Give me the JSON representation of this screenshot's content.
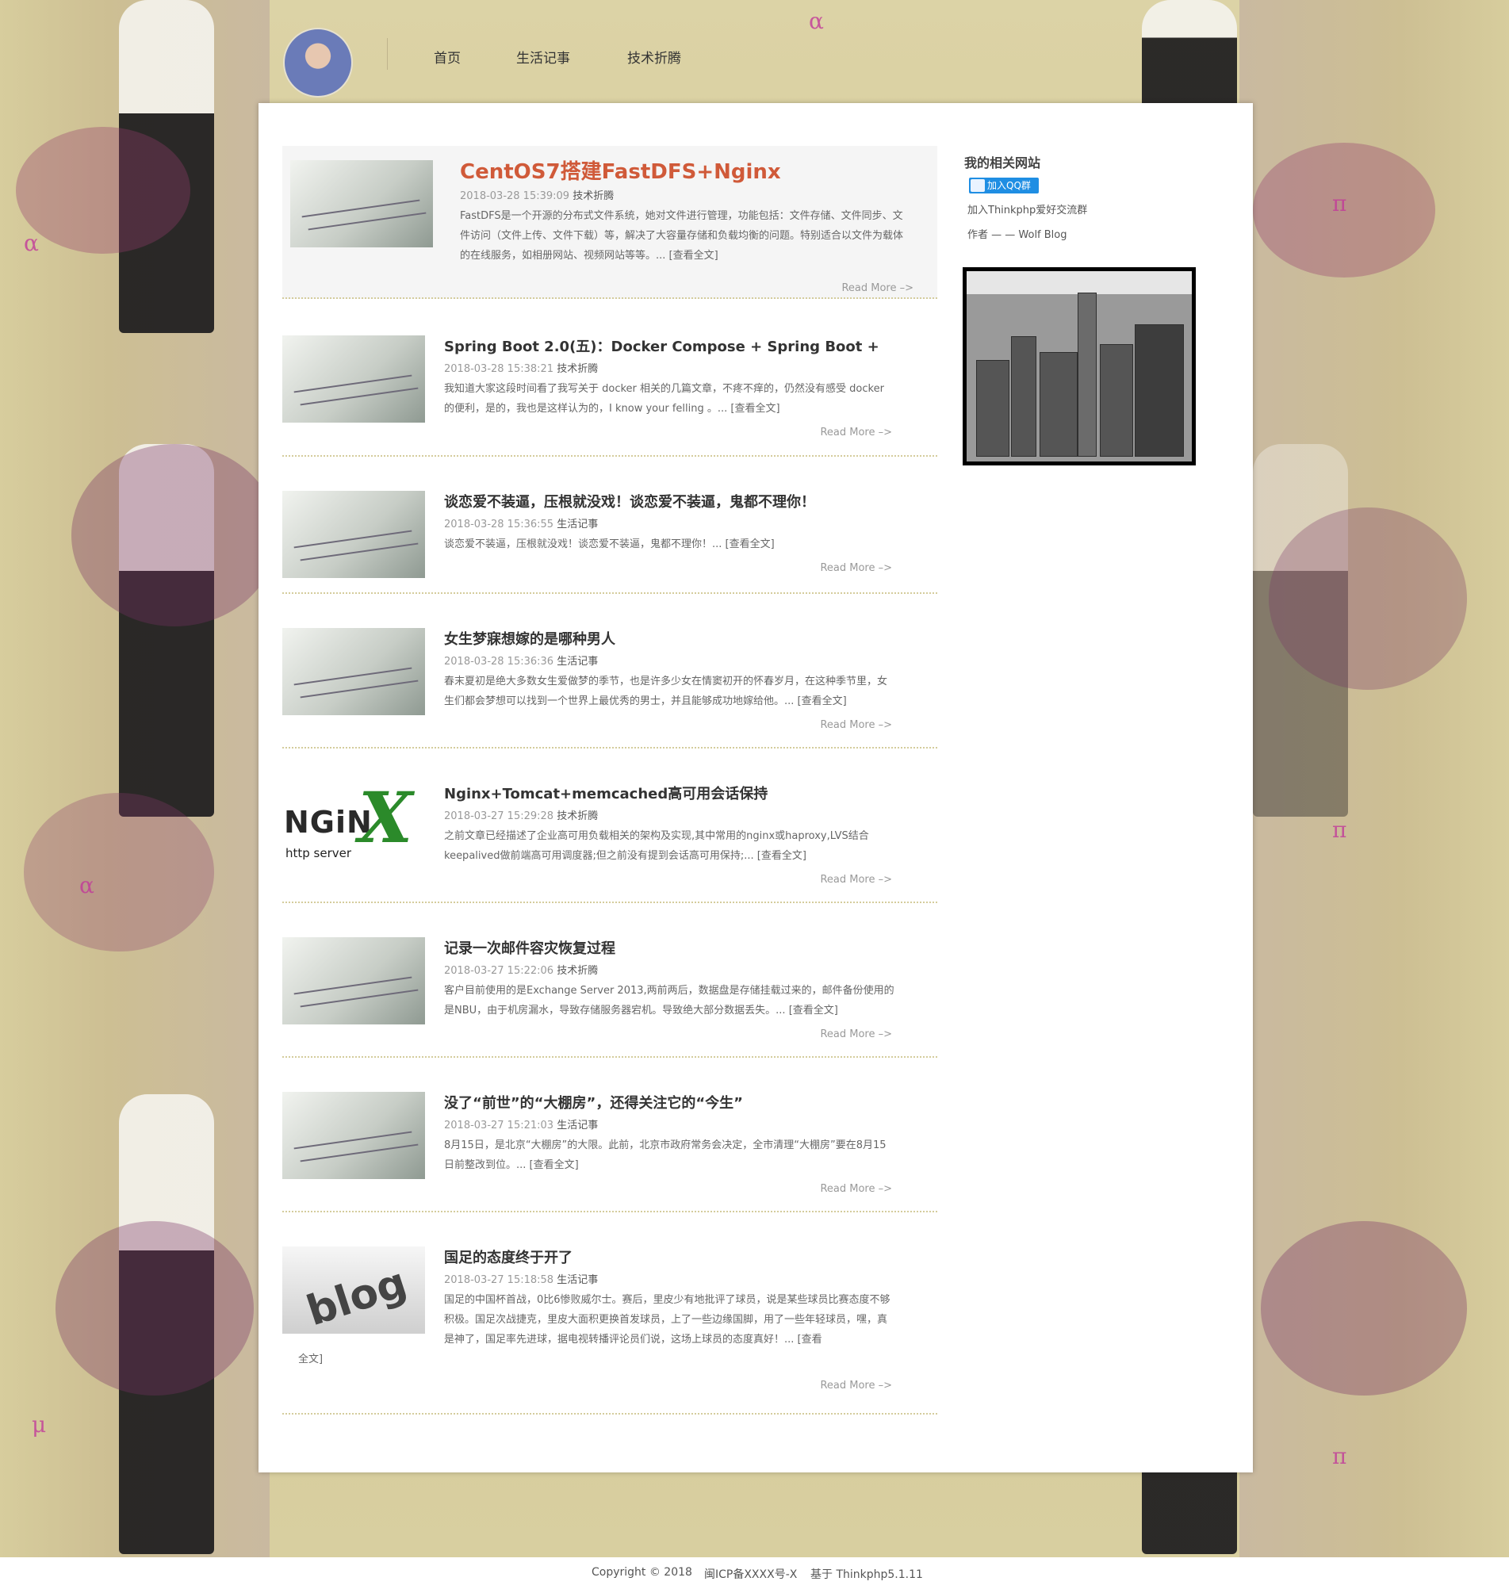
{
  "nav": {
    "items": [
      "首页",
      "生活记事",
      "技术折腾"
    ]
  },
  "posts": [
    {
      "title": "CentOS7搭建FastDFS+Nginx",
      "date": "2018-03-28 15:39:09",
      "category": "技术折腾",
      "excerpt": "FastDFS是一个开源的分布式文件系统，她对文件进行管理，功能包括：文件存储、文件同步、文件访问（文件上传、文件下载）等，解决了大容量存储和负载均衡的问题。特别适合以文件为载体的在线服务，如相册网站、视频网站等等。...",
      "more": "[查看全文]",
      "read_more": "Read More –>"
    },
    {
      "title": "Spring Boot 2.0(五)：Docker Compose + Spring Boot +",
      "date": "2018-03-28 15:38:21",
      "category": "技术折腾",
      "excerpt": "我知道大家这段时间看了我写关于 docker 相关的几篇文章，不疼不痒的，仍然没有感受 docker 的便利，是的，我也是这样认为的，I know your felling 。...",
      "more": "[查看全文]",
      "read_more": "Read More –>"
    },
    {
      "title": "谈恋爱不装逼，压根就没戏！谈恋爱不装逼，鬼都不理你！",
      "date": "2018-03-28 15:36:55",
      "category": "生活记事",
      "excerpt": "谈恋爱不装逼，压根就没戏！谈恋爱不装逼，鬼都不理你！...",
      "more": "[查看全文]",
      "read_more": "Read More –>"
    },
    {
      "title": "女生梦寐想嫁的是哪种男人",
      "date": "2018-03-28 15:36:36",
      "category": "生活记事",
      "excerpt": "春末夏初是绝大多数女生爱做梦的季节，也是许多少女在情窦初开的怀春岁月，在这种季节里，女生们都会梦想可以找到一个世界上最优秀的男士，并且能够成功地嫁给他。...",
      "more": "[查看全文]",
      "read_more": "Read More –>"
    },
    {
      "title": "Nginx+Tomcat+memcached高可用会话保持",
      "date": "2018-03-27 15:29:28",
      "category": "技术折腾",
      "excerpt": "之前文章已经描述了企业高可用负载相关的架构及实现,其中常用的nginx或haproxy,LVS结合keepalived做前端高可用调度器;但之前没有提到会话高可用保持;...",
      "more": "[查看全文]",
      "read_more": "Read More –>",
      "thumb_logo": {
        "word": "NGiN",
        "x": "X",
        "sub": "http server"
      }
    },
    {
      "title": "记录一次邮件容灾恢复过程",
      "date": "2018-03-27 15:22:06",
      "category": "技术折腾",
      "excerpt": "客户目前使用的是Exchange Server 2013,两前两后，数据盘是存储挂载过来的，邮件备份使用的是NBU，由于机房漏水，导致存储服务器宕机。导致绝大部分数据丢失。...",
      "more": "[查看全文]",
      "read_more": "Read More –>"
    },
    {
      "title": "没了“前世”的“大棚房”，还得关注它的“今生”",
      "date": "2018-03-27 15:21:03",
      "category": "生活记事",
      "excerpt": "8月15日，是北京“大棚房”的大限。此前，北京市政府常务会决定，全市清理“大棚房”要在8月15日前整改到位。...",
      "more": "[查看全文]",
      "read_more": "Read More –>"
    },
    {
      "title": "国足的态度终于开了",
      "date": "2018-03-27 15:18:58",
      "category": "生活记事",
      "excerpt": "国足的中国杯首战，0比6惨败威尔士。赛后，里皮少有地批评了球员，说是某些球员比赛态度不够积极。国足次战捷克，里皮大面积更换首发球员，上了一些边缘国脚，用了一些年轻球员，嘿，真是神了，国足率先进球，据电视转播评论员们说，这场上球员的态度真好！...",
      "more": "[查看",
      "more_tail": "全文]",
      "read_more": "Read More –>",
      "thumb_word": "blog"
    }
  ],
  "sidebar": {
    "heading": "我的相关网站",
    "qq_button": "加入QQ群",
    "group_link": "加入Thinkphp爱好交流群",
    "author": "作者 — — Wolf Blog"
  },
  "footer": {
    "copyright": "Copyright © 2018",
    "icp": "闽ICP备XXXX号-X",
    "powered": "基于 Thinkphp5.1.11"
  },
  "colors": {
    "featured_title": "#d05a39",
    "nginx_green": "#2b8a2a",
    "qq_blue": "#1f8ee3",
    "divider": "#d4cc9c"
  }
}
